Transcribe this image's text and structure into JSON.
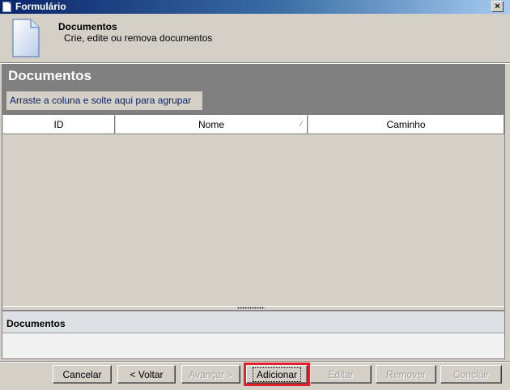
{
  "window": {
    "title": "Formulário",
    "close_glyph": "×"
  },
  "header": {
    "title": "Documentos",
    "subtitle": "Crie, edite ou remova documentos",
    "icon": "document-icon"
  },
  "grid": {
    "title": "Documentos",
    "group_hint": "Arraste a coluna e solte aqui para agrupar",
    "columns": [
      {
        "label": "ID"
      },
      {
        "label": "Nome",
        "sort_glyph": "⁄"
      },
      {
        "label": "Caminho"
      }
    ],
    "rows": []
  },
  "detail": {
    "label": "Documentos"
  },
  "buttons": {
    "cancelar": "Cancelar",
    "voltar": "< Voltar",
    "avancar": "Avançar >",
    "adicionar": "Adicionar",
    "editar": "Editar",
    "remover": "Remover",
    "concluir": "Concluir"
  },
  "colors": {
    "highlight": "#e0202a",
    "title_bar": "#0a246a",
    "group_area": "#808080"
  }
}
